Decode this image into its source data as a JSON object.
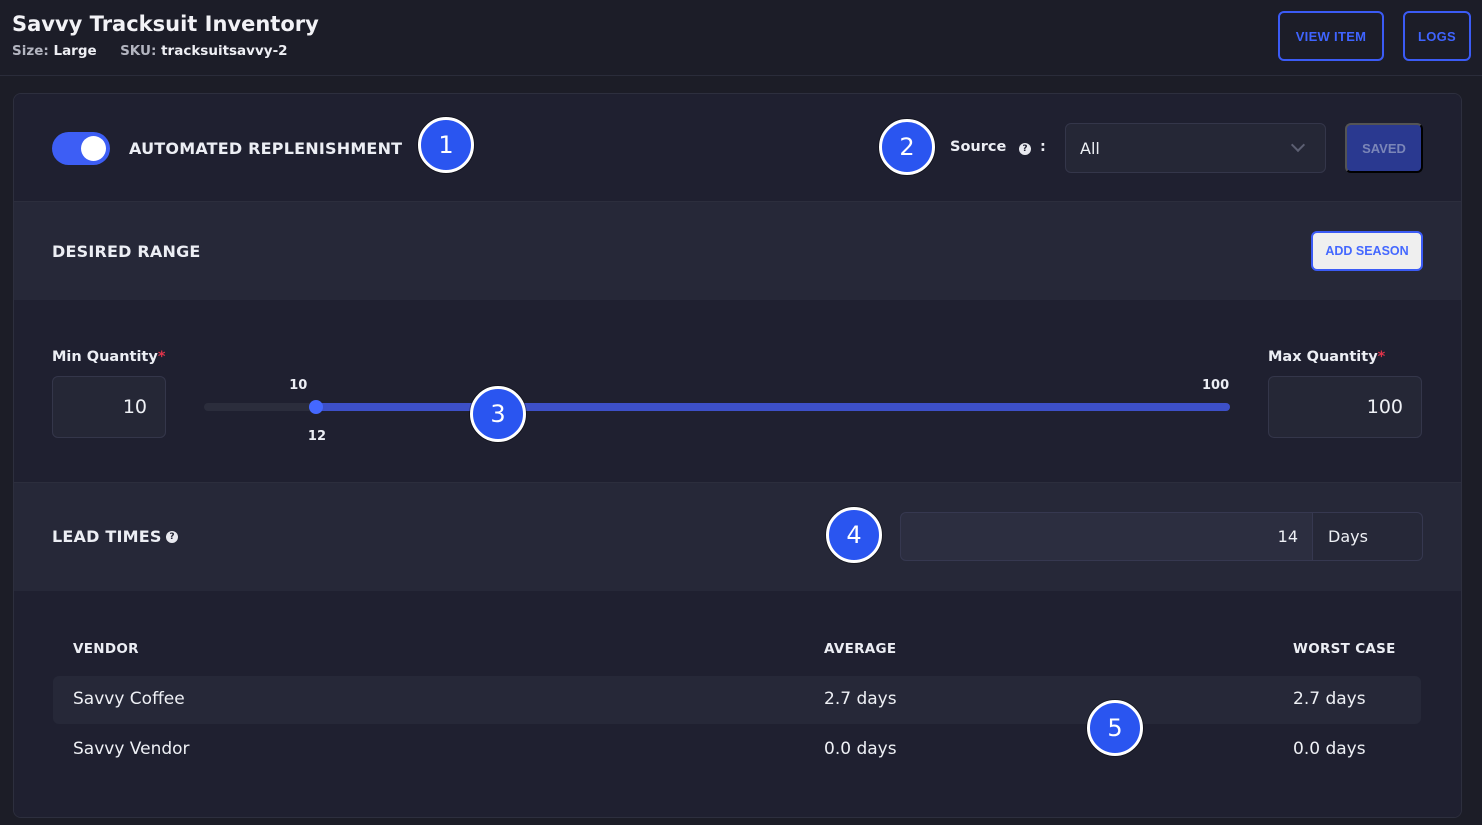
{
  "header": {
    "title": "Savvy Tracksuit Inventory",
    "size_label": "Size:",
    "size_value": "Large",
    "sku_label": "SKU:",
    "sku_value": "tracksuitsavvy-2",
    "view_item_label": "VIEW ITEM",
    "logs_label": "LOGS"
  },
  "replenishment": {
    "label": "AUTOMATED REPLENISHMENT",
    "enabled": true,
    "source_label": "Source",
    "source_colon": ":",
    "source_value": "All",
    "saved_label": "SAVED"
  },
  "desired_range": {
    "label": "DESIRED RANGE",
    "add_season_label": "ADD SEASON",
    "min_label": "Min Quantity",
    "max_label": "Max Quantity",
    "required_mark": "*",
    "min_value": "10",
    "max_value": "100",
    "slider": {
      "min": 10,
      "max": 100,
      "current": 12,
      "min_text": "10",
      "max_text": "100",
      "current_text": "12"
    }
  },
  "lead_times": {
    "label": "LEAD TIMES",
    "value": "14",
    "unit": "Days"
  },
  "vendor_table": {
    "columns": [
      "VENDOR",
      "AVERAGE",
      "WORST CASE"
    ],
    "rows": [
      {
        "vendor": "Savvy Coffee",
        "average": "2.7 days",
        "worst": "2.7 days"
      },
      {
        "vendor": "Savvy Vendor",
        "average": "0.0 days",
        "worst": "0.0 days"
      }
    ]
  },
  "markers": [
    "1",
    "2",
    "3",
    "4",
    "5"
  ],
  "colors": {
    "accent": "#3d5ef5",
    "background": "#1f2030",
    "section_alt": "#262838",
    "required": "#e0344a"
  }
}
